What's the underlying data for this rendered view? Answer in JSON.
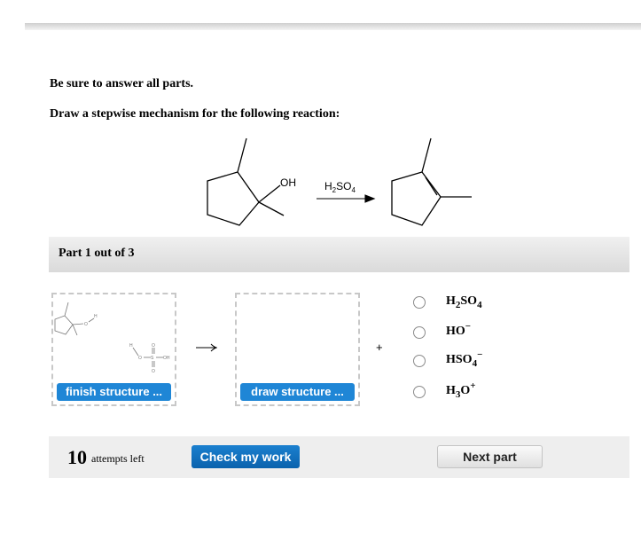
{
  "instructions": {
    "line1": "Be sure to answer all parts.",
    "line2": "Draw a stepwise mechanism for the following reaction:"
  },
  "reaction": {
    "reactant_label": "OH",
    "reagent_main": "H",
    "reagent_sub1": "2",
    "reagent_mid": "SO",
    "reagent_sub2": "4",
    "reactant": "1,2-dimethylcyclopentan-1-ol",
    "product": "1,2-dimethylcyclopentene"
  },
  "part": {
    "header": "Part 1 out of 3"
  },
  "workspace": {
    "box1": {
      "button": "finish structure ...",
      "atom_O": "O",
      "atom_H": "H",
      "acid_H": "H",
      "acid_O1": "O",
      "acid_S": "S",
      "acid_OH": "OH",
      "acid_O_top": "O",
      "acid_O_bottom": "O"
    },
    "box2": {
      "button": "draw structure ..."
    },
    "plus": "+"
  },
  "options": [
    {
      "main": "H",
      "sub": "2",
      "rest": "SO",
      "sub2": "4",
      "sup": ""
    },
    {
      "main": "HO",
      "sub": "",
      "rest": "",
      "sub2": "",
      "sup": "−"
    },
    {
      "main": "HSO",
      "sub": "4",
      "rest": "",
      "sub2": "",
      "sup": "−"
    },
    {
      "main": "H",
      "sub": "3",
      "rest": "O",
      "sub2": "",
      "sup": "+"
    }
  ],
  "footer": {
    "attempts_count": "10",
    "attempts_label": "attempts left",
    "check_button": "Check my work",
    "next_button": "Next part"
  }
}
